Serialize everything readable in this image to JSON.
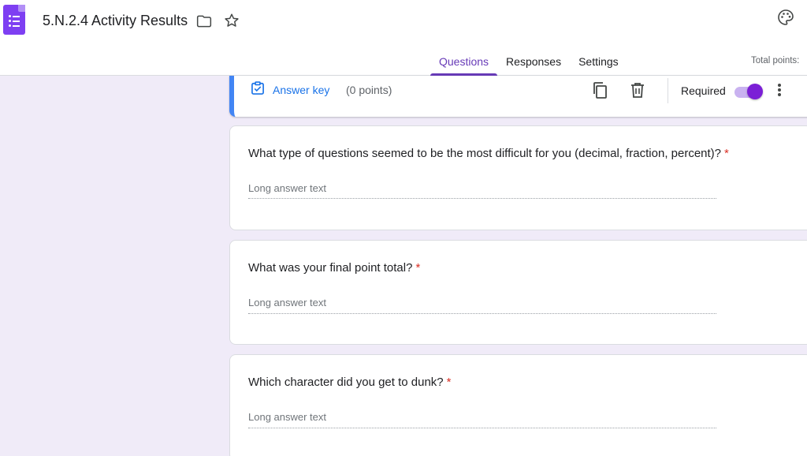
{
  "header": {
    "doc_title": "5.N.2.4 Activity Results",
    "icons": [
      "forms-app-icon",
      "folder-icon",
      "star-icon",
      "palette-icon"
    ],
    "tabs": [
      {
        "label": "Questions",
        "active": true
      },
      {
        "label": "Responses",
        "active": false
      },
      {
        "label": "Settings",
        "active": false
      }
    ],
    "total_points_label": "Total points:"
  },
  "answer_bar": {
    "answer_key_label": "Answer key",
    "points": "(0 points)",
    "required_label": "Required",
    "required_on": true
  },
  "questions": [
    {
      "title": "What type of questions seemed to be the most difficult for you (decimal, fraction, percent)?",
      "required_mark": "*",
      "placeholder": "Long answer text"
    },
    {
      "title": "What was your final point total?",
      "required_mark": "*",
      "placeholder": "Long answer text"
    },
    {
      "title": "Which character did you get to dunk?",
      "required_mark": "*",
      "placeholder": "Long answer text"
    }
  ],
  "colors": {
    "accent": "#673ab7",
    "background": "#f0ebf8",
    "link": "#1a73e8",
    "required": "#d93025",
    "toggle_on": "#7b1fd6"
  }
}
